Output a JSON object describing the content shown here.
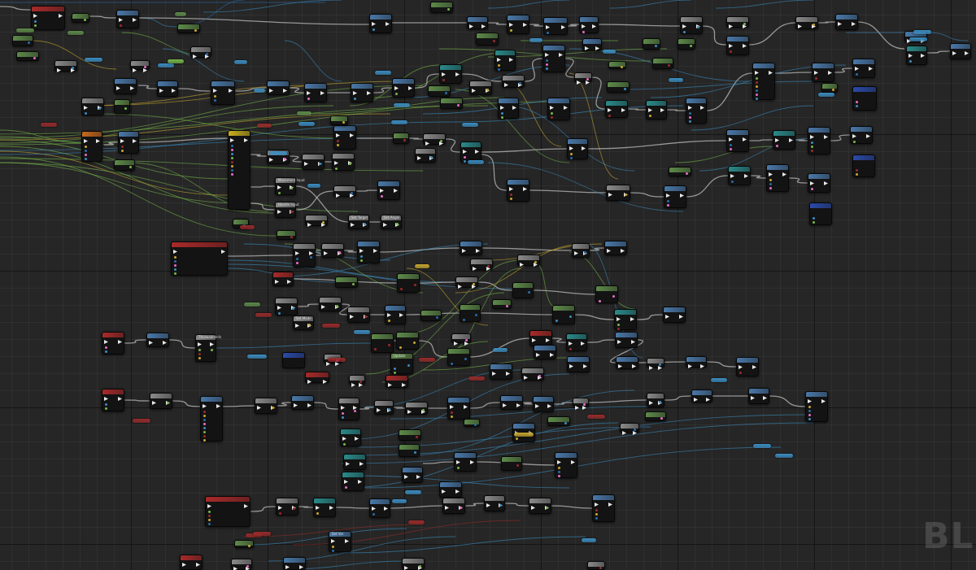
{
  "watermark": "BLU",
  "node_labels": {
    "ref_a": "Movement Input",
    "ref_b": "Handle Input",
    "ref_c": "Set Target",
    "ref_d": "Set Angle",
    "ref_e": "Set Mode",
    "ref_f": "ThrowableInfo",
    "ref_g": "Update",
    "ref_h": "Set Var"
  },
  "colors": {
    "canvas": "#262626",
    "node_body": "#131313",
    "hdr_event": "#a82a2a",
    "hdr_function": "#4a78a8",
    "hdr_pure": "#5e8a4a",
    "hdr_macro": "#8a8a8a",
    "hdr_cast": "#2b8a8a",
    "hdr_timeline": "#c8b020",
    "hdr_variable": "#c86a1e",
    "wire_exec": "#bdbdbd",
    "wire_object": "#3b8dc2",
    "wire_float": "#76b84a",
    "wire_struct": "#2a6aa8",
    "wire_bool": "#9a2a2a",
    "wire_vector": "#c8a830"
  }
}
